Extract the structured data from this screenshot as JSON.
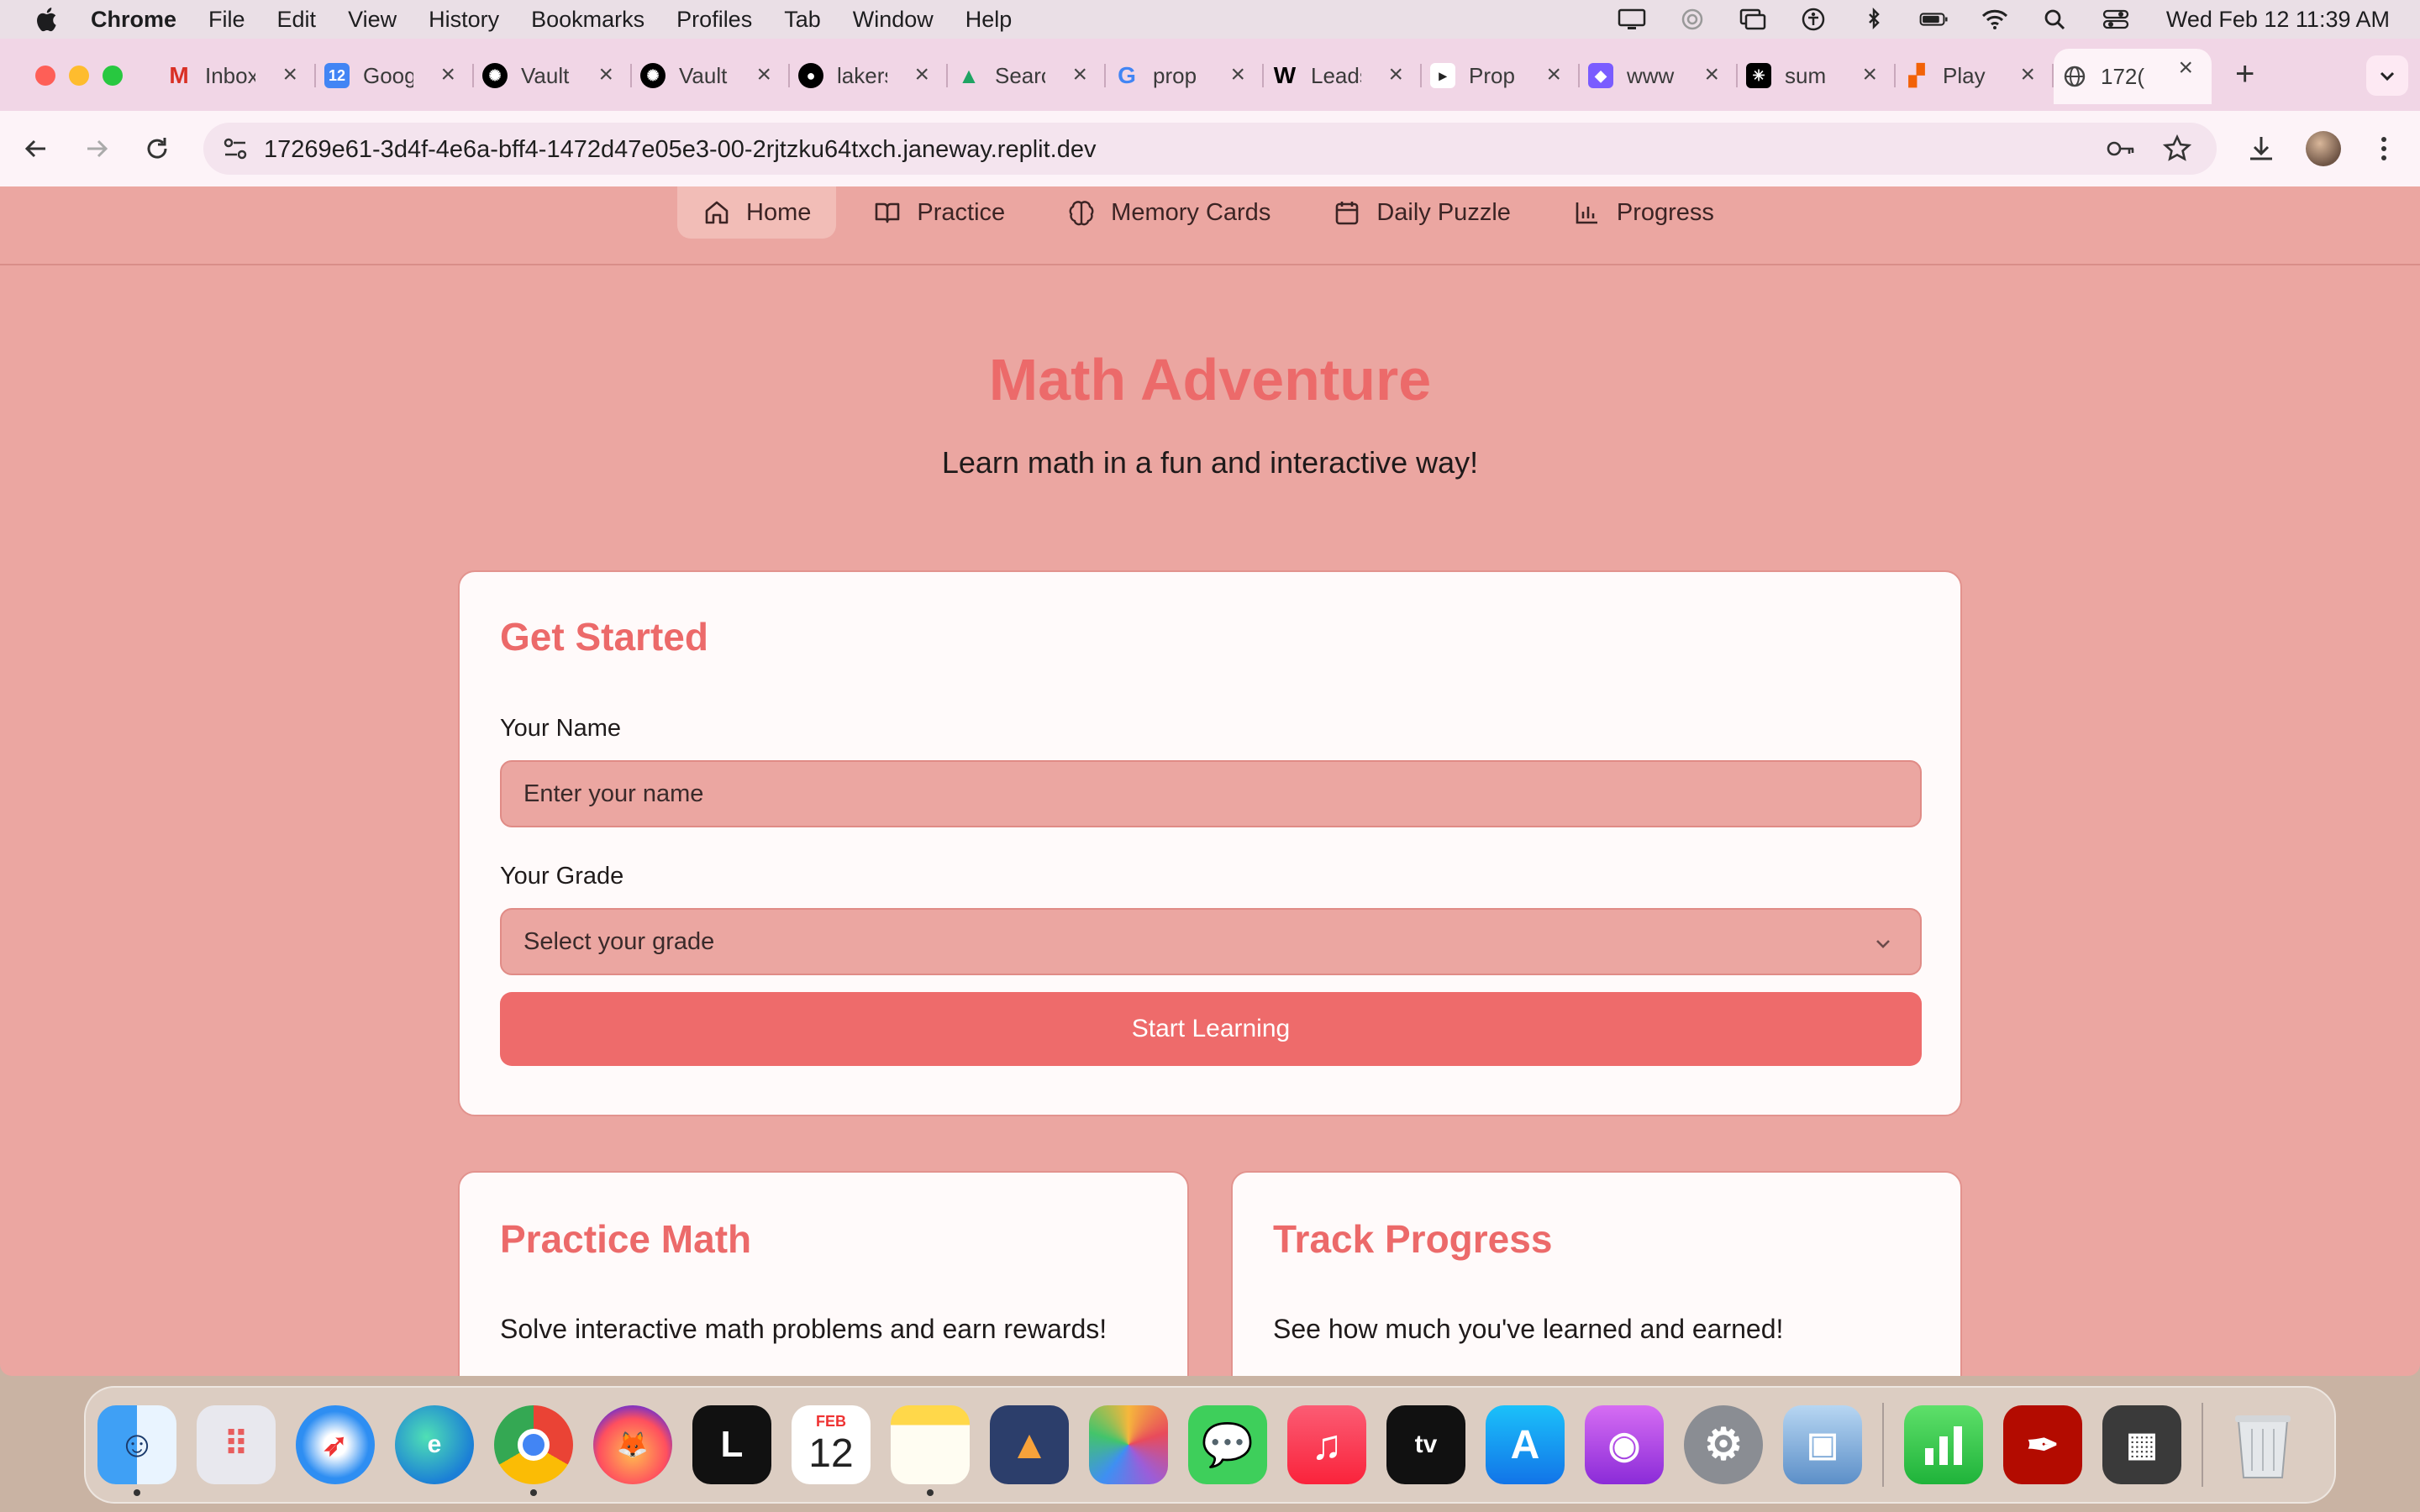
{
  "menubar": {
    "app_name": "Chrome",
    "items": [
      "File",
      "Edit",
      "View",
      "History",
      "Bookmarks",
      "Profiles",
      "Tab",
      "Window",
      "Help"
    ],
    "clock": "Wed Feb 12  11:39 AM"
  },
  "tabs": [
    {
      "label": "Inbox",
      "icon": "gmail-icon",
      "color": "#ffffff"
    },
    {
      "label": "Google",
      "icon": "calendar-icon",
      "color": "#4285f4"
    },
    {
      "label": "Vault",
      "icon": "openai-icon",
      "color": "#000000"
    },
    {
      "label": "Vault",
      "icon": "openai-icon",
      "color": "#000000"
    },
    {
      "label": "lakers",
      "icon": "github-icon",
      "color": "#000000"
    },
    {
      "label": "Search",
      "icon": "drive-icon",
      "color": "#ffffff"
    },
    {
      "label": "prop",
      "icon": "google-icon",
      "color": "#ffffff"
    },
    {
      "label": "Leads",
      "icon": "w-icon",
      "color": "#000000"
    },
    {
      "label": "Prop",
      "icon": "tab-icon",
      "color": "#ffffff"
    },
    {
      "label": "www",
      "icon": "badge-icon",
      "color": "#7a5cff"
    },
    {
      "label": "sum",
      "icon": "perplexity-icon",
      "color": "#000000"
    },
    {
      "label": "Play",
      "icon": "replit-icon",
      "color": "#ffffff"
    },
    {
      "label": "172(",
      "icon": "globe-icon",
      "color": "#ffffff"
    }
  ],
  "toolbar": {
    "url": "17269e61-3d4f-4e6a-bff4-1472d47e05e3-00-2rjtzku64txch.janeway.replit.dev"
  },
  "nav": [
    {
      "label": "Home",
      "icon": "home-icon",
      "active": true
    },
    {
      "label": "Practice",
      "icon": "book-icon",
      "active": false
    },
    {
      "label": "Memory Cards",
      "icon": "brain-icon",
      "active": false
    },
    {
      "label": "Daily Puzzle",
      "icon": "calendar-icon",
      "active": false
    },
    {
      "label": "Progress",
      "icon": "bar-chart-icon",
      "active": false
    }
  ],
  "hero": {
    "title": "Math Adventure",
    "subtitle": "Learn math in a fun and interactive way!"
  },
  "start_card": {
    "title": "Get Started",
    "name_label": "Your Name",
    "name_placeholder": "Enter your name",
    "grade_label": "Your Grade",
    "grade_value": "Select your grade",
    "button": "Start Learning"
  },
  "practice_card": {
    "title": "Practice Math",
    "text": "Solve interactive math problems and earn rewards!"
  },
  "progress_card": {
    "title": "Track Progress",
    "text": "See how much you've learned and earned!"
  },
  "dock": {
    "calendar_month": "FEB",
    "calendar_day": "12"
  },
  "colors": {
    "accent": "#ec6a6a",
    "page_bg": "#eba6a1",
    "card_bg": "#fffafa"
  }
}
